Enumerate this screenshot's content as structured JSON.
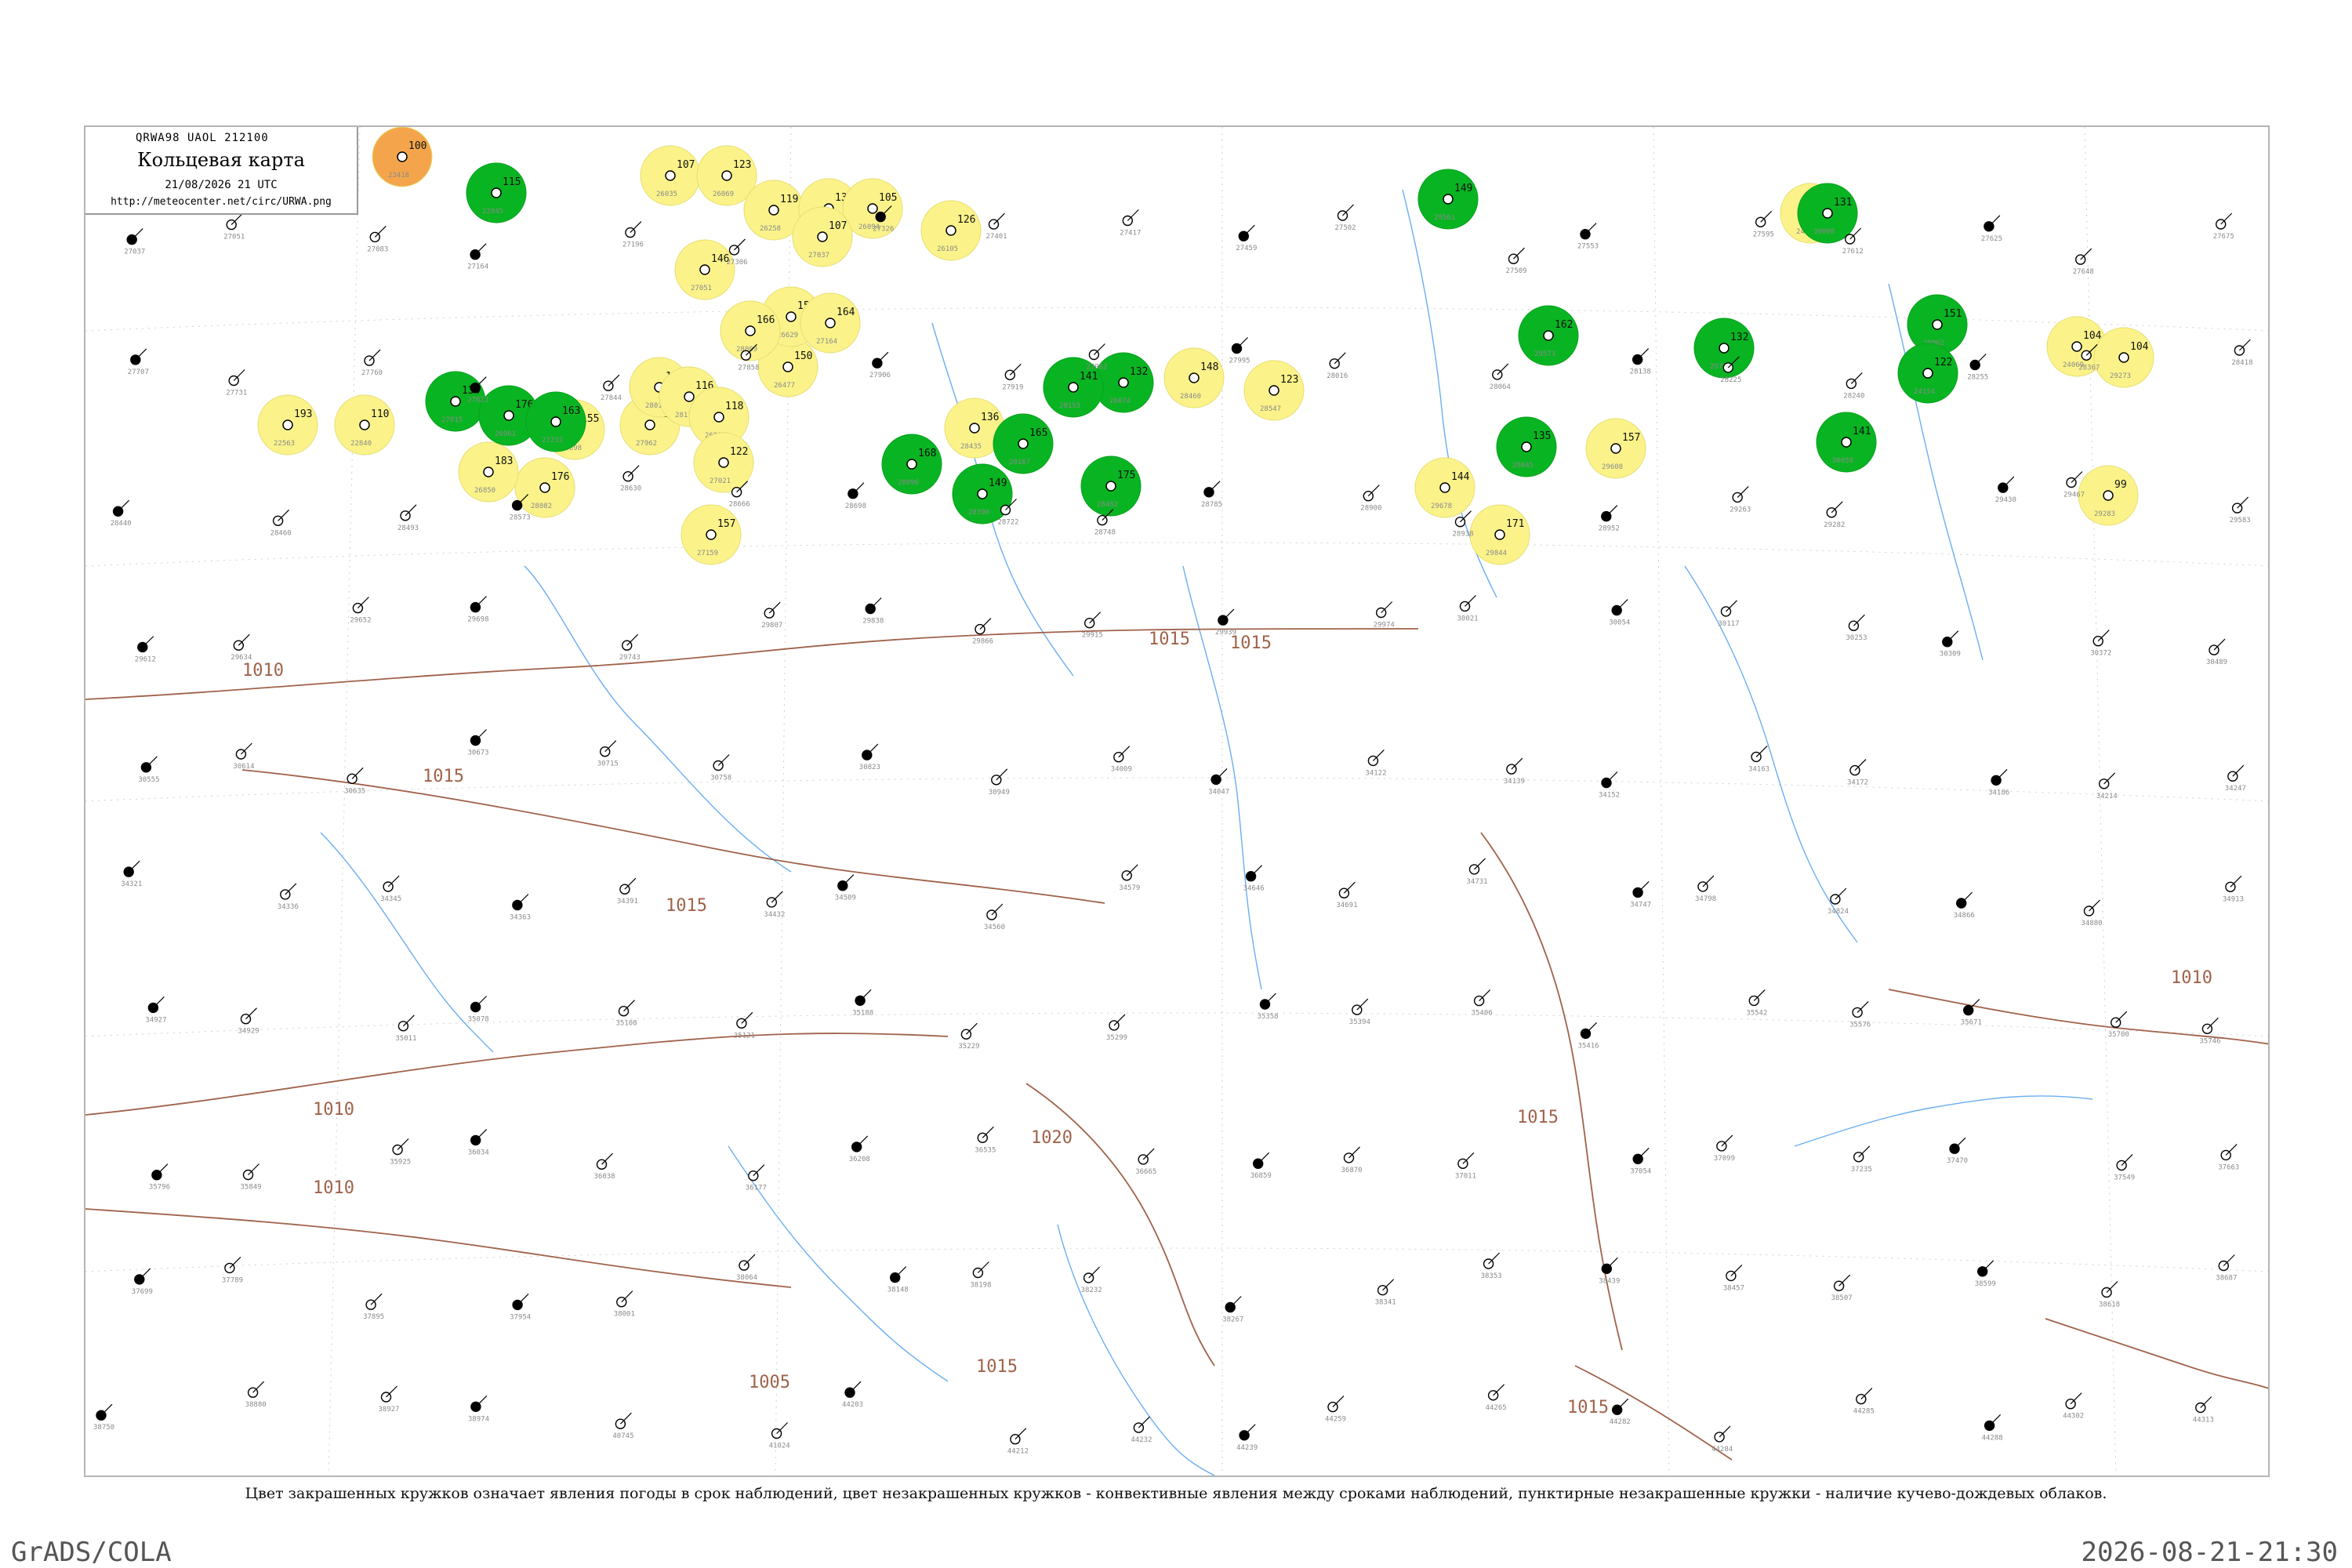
{
  "header": {
    "code": "QRWA98  UAOL  212100",
    "title": "Кольцевая карта",
    "datetime": "21/08/2026 21 UTC",
    "url": "http://meteocenter.net/circ/URWA.png"
  },
  "caption": "Цвет закрашенных кружков означает явления погоды в срок наблюдений, цвет незакрашенных кружков - конвективные явления между сроками наблюдений, пунктирные незакрашенные кружки - наличие кучево-дождевых облаков.",
  "footer": {
    "left": "GrADS/COLA",
    "right": "2026-08-21-21:30"
  },
  "colors": {
    "green": "#09b422",
    "yellow": "#fbf38a",
    "orange": "#f4a54b",
    "river": "#6aaef2",
    "isobar": "#a0624a",
    "text": "#222222",
    "station_id": "#8a8a8a"
  },
  "isobar_labels": [
    "1015",
    "1010",
    "1005",
    "1020"
  ],
  "highlighted_stations": [
    {
      "id": "23418",
      "p": "100",
      "c": "orange"
    },
    {
      "id": "22845",
      "p": "115",
      "c": "green"
    },
    {
      "id": "26035",
      "p": "107",
      "c": "yellow"
    },
    {
      "id": "26069",
      "p": "123",
      "c": "yellow"
    },
    {
      "id": "26258",
      "p": "119",
      "c": "yellow"
    },
    {
      "id": "26298",
      "p": "133",
      "c": "yellow"
    },
    {
      "id": "26094",
      "p": "105",
      "c": "yellow"
    },
    {
      "id": "26105",
      "p": "126",
      "c": "yellow"
    },
    {
      "id": "27037",
      "p": "107",
      "c": "yellow"
    },
    {
      "id": "27051",
      "p": "146",
      "c": "yellow"
    },
    {
      "id": "26477",
      "p": "150",
      "c": "yellow"
    },
    {
      "id": "26629",
      "p": "156",
      "c": "yellow"
    },
    {
      "id": "27164",
      "p": "164",
      "c": "yellow"
    },
    {
      "id": "28009",
      "p": "166",
      "c": "yellow"
    },
    {
      "id": "22563",
      "p": "193",
      "c": "yellow"
    },
    {
      "id": "22840",
      "p": "110",
      "c": "yellow"
    },
    {
      "id": "28082",
      "p": "176",
      "c": "yellow"
    },
    {
      "id": "26850",
      "p": "183",
      "c": "yellow"
    },
    {
      "id": "26898",
      "p": "155",
      "c": "yellow"
    },
    {
      "id": "27962",
      "p": "125",
      "c": "yellow"
    },
    {
      "id": "28011",
      "p": "162",
      "c": "yellow"
    },
    {
      "id": "28116",
      "p": "116",
      "c": "yellow"
    },
    {
      "id": "26999",
      "p": "118",
      "c": "yellow"
    },
    {
      "id": "27021",
      "p": "122",
      "c": "yellow"
    },
    {
      "id": "27159",
      "p": "157",
      "c": "yellow"
    },
    {
      "id": "28435",
      "p": "136",
      "c": "yellow"
    },
    {
      "id": "28460",
      "p": "148",
      "c": "yellow"
    },
    {
      "id": "28547",
      "p": "123",
      "c": "yellow"
    },
    {
      "id": "29608",
      "p": "157",
      "c": "yellow"
    },
    {
      "id": "29678",
      "p": "144",
      "c": "yellow"
    },
    {
      "id": "29844",
      "p": "171",
      "c": "yellow"
    },
    {
      "id": "24050",
      "p": "104",
      "c": "yellow"
    },
    {
      "id": "24069",
      "p": "104",
      "c": "yellow"
    },
    {
      "id": "29273",
      "p": "104",
      "c": "yellow"
    },
    {
      "id": "29283",
      "p": "99",
      "c": "yellow"
    },
    {
      "id": "27015",
      "p": "134",
      "c": "green"
    },
    {
      "id": "26961",
      "p": "176",
      "c": "green"
    },
    {
      "id": "27232",
      "p": "163",
      "c": "green"
    },
    {
      "id": "28096",
      "p": "168",
      "c": "green"
    },
    {
      "id": "26074",
      "p": "132",
      "c": "green"
    },
    {
      "id": "28153",
      "p": "141",
      "c": "green"
    },
    {
      "id": "28167",
      "p": "165",
      "c": "green"
    },
    {
      "id": "28390",
      "p": "149",
      "c": "green"
    },
    {
      "id": "28462",
      "p": "175",
      "c": "green"
    },
    {
      "id": "29561",
      "p": "149",
      "c": "green"
    },
    {
      "id": "29573",
      "p": "162",
      "c": "green"
    },
    {
      "id": "29645",
      "p": "135",
      "c": "green"
    },
    {
      "id": "29737",
      "p": "132",
      "c": "green"
    },
    {
      "id": "29862",
      "p": "151",
      "c": "green"
    },
    {
      "id": "30058",
      "p": "141",
      "c": "green"
    },
    {
      "id": "24154",
      "p": "122",
      "c": "green"
    },
    {
      "id": "30090",
      "p": "131",
      "c": "green"
    }
  ],
  "regular_stations": [
    "27037",
    "27051",
    "27083",
    "27164",
    "27196",
    "27306",
    "27326",
    "27401",
    "27417",
    "27459",
    "27502",
    "27509",
    "27553",
    "27595",
    "27612",
    "27625",
    "27648",
    "27675",
    "27707",
    "27731",
    "27760",
    "27823",
    "27844",
    "27858",
    "27906",
    "27919",
    "27962",
    "27995",
    "28016",
    "28064",
    "28138",
    "28225",
    "28240",
    "28255",
    "28367",
    "28418",
    "28440",
    "28460",
    "28493",
    "28573",
    "28630",
    "28666",
    "28698",
    "28722",
    "28748",
    "28785",
    "28900",
    "28938",
    "28952",
    "29263",
    "29282",
    "29430",
    "29467",
    "29583",
    "29612",
    "29634",
    "29652",
    "29698",
    "29743",
    "29807",
    "29838",
    "29866",
    "29915",
    "29939",
    "29974",
    "30021",
    "30054",
    "30117",
    "30253",
    "30309",
    "30372",
    "30489",
    "30555",
    "30614",
    "30635",
    "30673",
    "30715",
    "30758",
    "30823",
    "30949",
    "34009",
    "34047",
    "34122",
    "34139",
    "34152",
    "34163",
    "34172",
    "34186",
    "34214",
    "34247",
    "34321",
    "34336",
    "34345",
    "34363",
    "34391",
    "34432",
    "34509",
    "34560",
    "34579",
    "34646",
    "34691",
    "34731",
    "34747",
    "34798",
    "34824",
    "34866",
    "34880",
    "34913",
    "34927",
    "34929",
    "35011",
    "35078",
    "35108",
    "35121",
    "35188",
    "35229",
    "35299",
    "35358",
    "35394",
    "35406",
    "35416",
    "35542",
    "35576",
    "35671",
    "35700",
    "35746",
    "35796",
    "35849",
    "35925",
    "36034",
    "36038",
    "36177",
    "36208",
    "36535",
    "36665",
    "36859",
    "36870",
    "37011",
    "37054",
    "37099",
    "37235",
    "37470",
    "37549",
    "37663",
    "37699",
    "37789",
    "37895",
    "37954",
    "38001",
    "38064",
    "38148",
    "38198",
    "38232",
    "38267",
    "38341",
    "38353",
    "38439",
    "38457",
    "38507",
    "38599",
    "38618",
    "38687",
    "38750",
    "38880",
    "38927",
    "38974",
    "40745",
    "41024",
    "44203",
    "44212",
    "44232",
    "44239",
    "44259",
    "44265",
    "44282",
    "44284",
    "44285",
    "44288",
    "44302",
    "44313"
  ]
}
